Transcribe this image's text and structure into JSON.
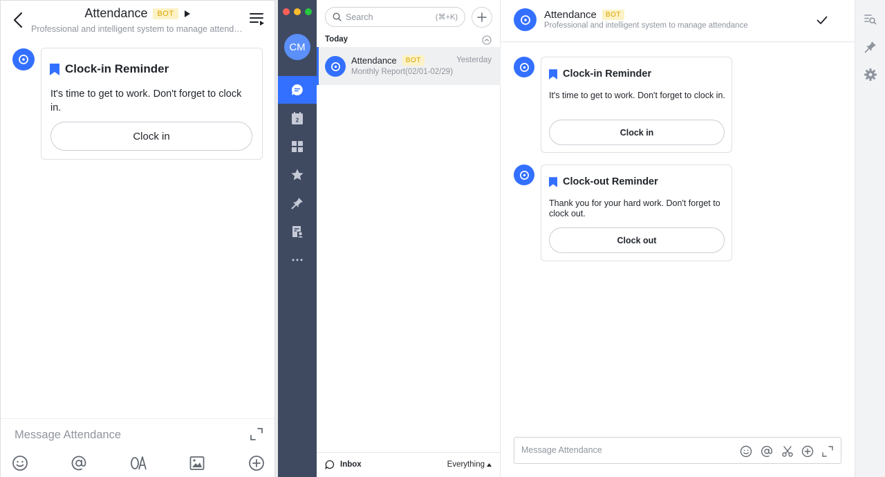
{
  "mobile": {
    "title": "Attendance",
    "badge": "BOT",
    "subtitle": "Professional and intelligent system to manage attendance",
    "card": {
      "title": "Clock-in Reminder",
      "body": "It's time to get to work. Don't forget to clock in.",
      "button": "Clock in"
    },
    "input_placeholder": "Message Attendance",
    "toolbar_icons": [
      "emoji-icon",
      "mention-icon",
      "oa-icon",
      "image-icon",
      "plus-icon"
    ]
  },
  "nav": {
    "avatar_initials": "CM",
    "items": [
      "chat-icon",
      "calendar-icon",
      "apps-icon",
      "favorites-icon",
      "pin-icon",
      "docs-icon",
      "more-icon"
    ],
    "calendar_day": "2",
    "accent": "#3370ff"
  },
  "chat_list": {
    "search_placeholder": "Search",
    "search_shortcut": "(⌘+K)",
    "section": "Today",
    "items": [
      {
        "name": "Attendance",
        "badge": "BOT",
        "time": "Yesterday",
        "preview": "Monthly Report(02/01-02/29)"
      }
    ],
    "footer": {
      "inbox": "Inbox",
      "filter": "Everything"
    }
  },
  "desktop_chat": {
    "title": "Attendance",
    "badge": "BOT",
    "subtitle": "Professional and intelligent system to manage attendance",
    "messages": [
      {
        "title": "Clock-in Reminder",
        "body": "It's time to get to work. Don't forget to clock in.",
        "button": "Clock in"
      },
      {
        "title": "Clock-out Reminder",
        "body": "Thank you for your hard work. Don't forget to clock out.",
        "button": "Clock out"
      }
    ],
    "input_placeholder": "Message Attendance",
    "toolbar_icons": [
      "emoji-icon",
      "mention-icon",
      "scissors-icon",
      "plus-icon",
      "expand-icon"
    ]
  },
  "right_rail": {
    "icons": [
      "search-history-icon",
      "pin-icon",
      "settings-icon"
    ]
  }
}
